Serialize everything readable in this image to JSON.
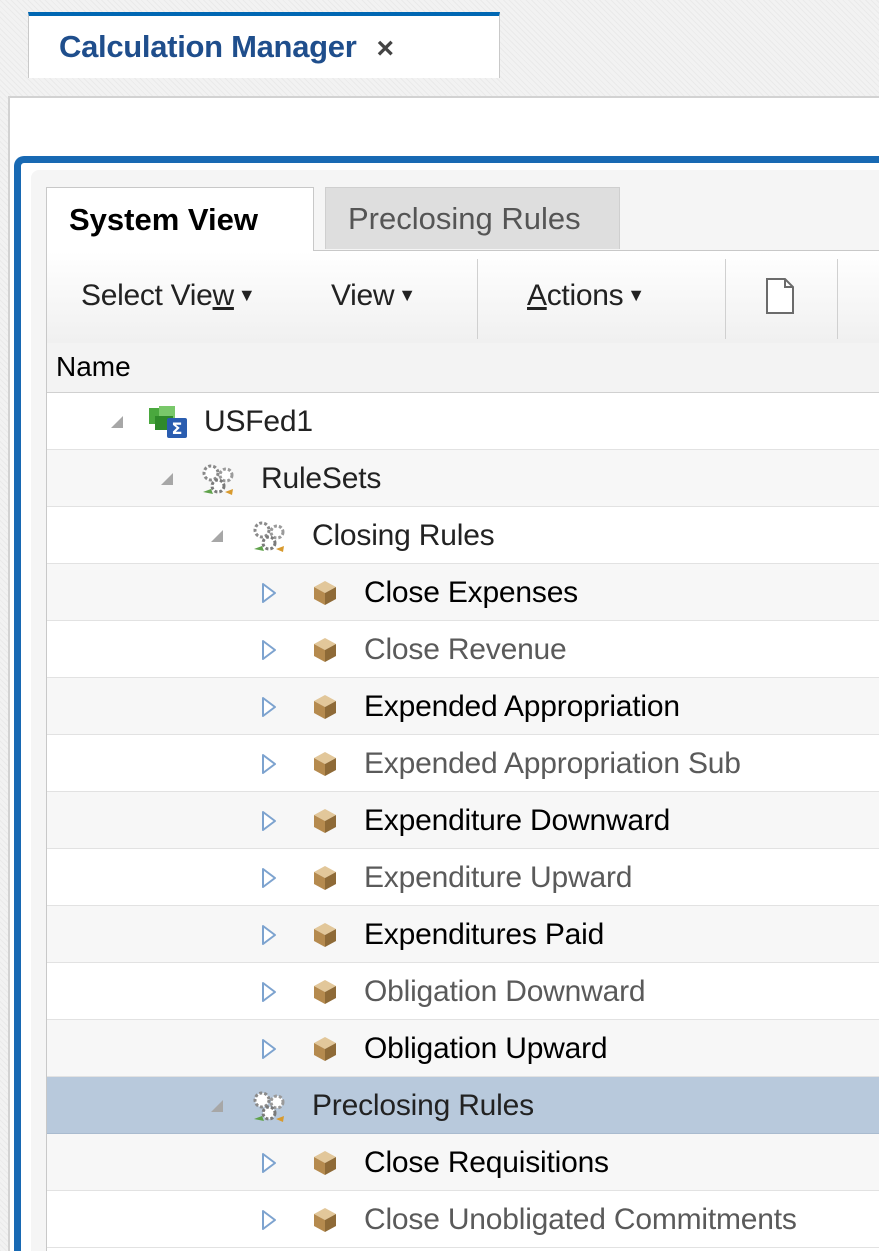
{
  "document_tab": {
    "title": "Calculation Manager",
    "close_glyph": "×"
  },
  "inner_tabs": [
    {
      "label": "System View",
      "active": true
    },
    {
      "label": "Preclosing Rules",
      "active": false
    }
  ],
  "toolbar": {
    "select_view": {
      "pre": "Select Vie",
      "mnemonic": "w",
      "caret": "▼"
    },
    "view": {
      "label": "View",
      "caret": "▼"
    },
    "actions": {
      "mnemonic": "A",
      "post": "ctions",
      "caret": "▼"
    },
    "new_icon": "new-document-icon"
  },
  "column_header": "Name",
  "tree": [
    {
      "label": "USFed1",
      "level": 0,
      "expanded": true,
      "icon": "application-cube-icon"
    },
    {
      "label": "RuleSets",
      "level": 1,
      "expanded": true,
      "icon": "ruleset-gears-icon"
    },
    {
      "label": "Closing Rules",
      "level": 2,
      "expanded": true,
      "icon": "ruleset-gears-icon"
    },
    {
      "label": "Close Expenses",
      "level": 3,
      "expanded": false,
      "icon": "rule-cube-icon"
    },
    {
      "label": "Close Revenue",
      "level": 3,
      "expanded": false,
      "icon": "rule-cube-icon"
    },
    {
      "label": "Expended Appropriation",
      "level": 3,
      "expanded": false,
      "icon": "rule-cube-icon"
    },
    {
      "label": "Expended Appropriation Sub",
      "level": 3,
      "expanded": false,
      "icon": "rule-cube-icon"
    },
    {
      "label": "Expenditure Downward",
      "level": 3,
      "expanded": false,
      "icon": "rule-cube-icon"
    },
    {
      "label": "Expenditure Upward",
      "level": 3,
      "expanded": false,
      "icon": "rule-cube-icon"
    },
    {
      "label": "Expenditures Paid",
      "level": 3,
      "expanded": false,
      "icon": "rule-cube-icon"
    },
    {
      "label": "Obligation Downward",
      "level": 3,
      "expanded": false,
      "icon": "rule-cube-icon"
    },
    {
      "label": "Obligation Upward",
      "level": 3,
      "expanded": false,
      "icon": "rule-cube-icon"
    },
    {
      "label": "Preclosing Rules",
      "level": 2,
      "expanded": true,
      "selected": true,
      "icon": "ruleset-gears-icon"
    },
    {
      "label": "Close Requisitions",
      "level": 3,
      "expanded": false,
      "icon": "rule-cube-icon"
    },
    {
      "label": "Close Unobligated Commitments",
      "level": 3,
      "expanded": false,
      "icon": "rule-cube-icon"
    }
  ],
  "colors": {
    "accent": "#1869b3",
    "tab_title": "#1f4e8c",
    "selected_row": "#b8c9dc",
    "expander": "#7da3cf"
  }
}
